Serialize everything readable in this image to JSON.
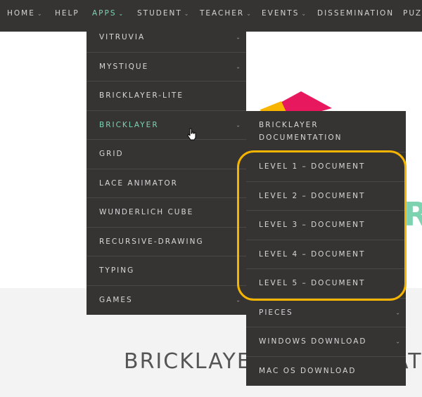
{
  "nav": {
    "items": [
      {
        "label": "HOME",
        "chevron": true
      },
      {
        "label": "HELP",
        "chevron": false
      },
      {
        "label": "APPS",
        "chevron": true,
        "active": true
      },
      {
        "label": "STUDENT",
        "chevron": true
      },
      {
        "label": "TEACHER",
        "chevron": true
      },
      {
        "label": "EVENTS",
        "chevron": true
      },
      {
        "label": "DISSEMINATION",
        "chevron": false
      },
      {
        "label": "PUZ",
        "chevron": false
      }
    ]
  },
  "apps_menu": {
    "items": [
      {
        "label": "VITRUVIA",
        "chevron": true
      },
      {
        "label": "MYSTIQUE",
        "chevron": true
      },
      {
        "label": "BRICKLAYER-LITE",
        "chevron": false
      },
      {
        "label": "BRICKLAYER",
        "chevron": true,
        "active": true
      },
      {
        "label": "GRID",
        "chevron": false
      },
      {
        "label": "LACE ANIMATOR",
        "chevron": false
      },
      {
        "label": "WUNDERLICH CUBE",
        "chevron": false
      },
      {
        "label": "RECURSIVE-DRAWING",
        "chevron": false
      },
      {
        "label": "TYPING",
        "chevron": false
      },
      {
        "label": "GAMES",
        "chevron": true
      }
    ]
  },
  "bricklayer_submenu": {
    "items": [
      {
        "label_line1": "BRICKLAYER",
        "label_line2": "DOCUMENTATION",
        "chevron": false
      },
      {
        "label": "LEVEL 1 – DOCUMENT",
        "chevron": false
      },
      {
        "label": "LEVEL 2 – DOCUMENT",
        "chevron": false
      },
      {
        "label": "LEVEL 3 – DOCUMENT",
        "chevron": false
      },
      {
        "label": "LEVEL 4 – DOCUMENT",
        "chevron": false
      },
      {
        "label": "LEVEL 5 – DOCUMENT",
        "chevron": false
      },
      {
        "label": "PIECES",
        "chevron": true
      },
      {
        "label": "WINDOWS DOWNLOAD",
        "chevron": true
      },
      {
        "label": "MAC OS DOWNLOAD",
        "chevron": false
      }
    ]
  },
  "page": {
    "title_visible": "BRICKLAYE",
    "title_tail": "AT",
    "hero_letter": "R"
  },
  "icons": {
    "chevron": "chevron-down-icon",
    "cursor": "hand-pointer-icon",
    "logo": "bricklayer-logo"
  },
  "colors": {
    "nav_bg": "#363432",
    "accent": "#7dd3b0",
    "highlight": "#f4b400",
    "logo_pink": "#e8185e",
    "logo_yellow": "#f7b500"
  }
}
